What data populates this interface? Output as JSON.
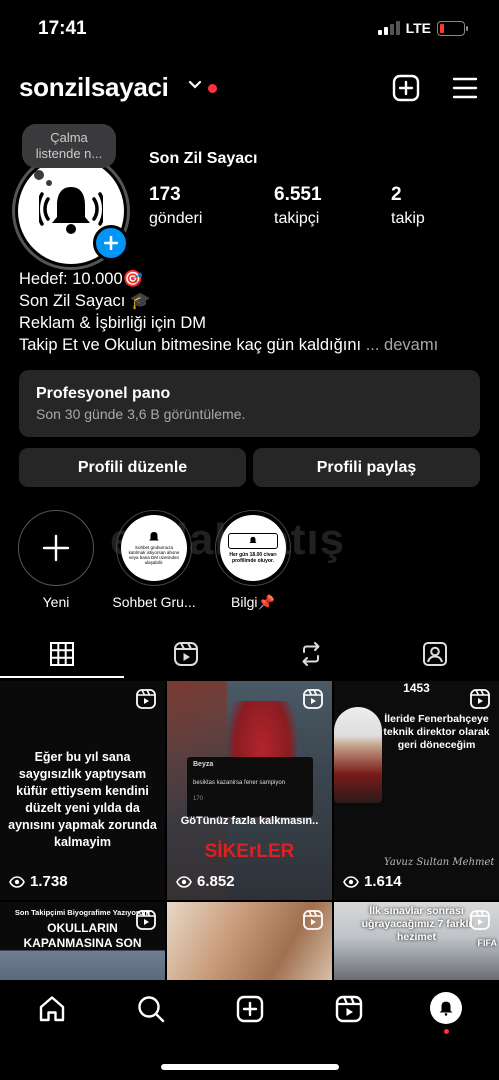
{
  "status_bar": {
    "time": "17:41",
    "network": "LTE",
    "battery_level": 0.15
  },
  "header": {
    "username": "sonzilsayaci"
  },
  "note": {
    "line1": "Çalma",
    "line2": "listende n..."
  },
  "profile": {
    "display_name": "Son Zil Sayacı",
    "stats": [
      {
        "value": "173",
        "label": "gönderi"
      },
      {
        "value": "6.551",
        "label": "takipçi"
      },
      {
        "value": "2",
        "label": "takip"
      }
    ],
    "bio_lines": [
      "Hedef: 10.000🎯",
      "Son Zil Sayacı 🎓",
      "Reklam & İşbirliği için DM",
      "Takip Et ve Okulun bitmesine kaç gün kaldığını"
    ],
    "bio_more": "... devamı"
  },
  "dashboard": {
    "title": "Profesyonel pano",
    "subtitle": "Son 30 günde 3,6 B görüntüleme."
  },
  "buttons": {
    "edit": "Profili düzenle",
    "share": "Profili paylaş"
  },
  "highlights": [
    {
      "label": "Yeni"
    },
    {
      "label": "Sohbet Gru..."
    },
    {
      "label": "Bilgi📌"
    }
  ],
  "highlight_texts": {
    "sohbet": "Sohbet grubumuza katılmak istiyorsan abone veya bana DM üzerinden ulaşabilir.",
    "bilgi": "Her gün 18.00 civarı profilimde oluyor."
  },
  "watermark": "emlaksatış",
  "grid": [
    {
      "views": "1.738",
      "text": "Eğer bu yıl sana saygısızlık yaptıysam küfür ettiysem kendini düzelt yeni yılda da aynısını yapmak zorunda kalmayim"
    },
    {
      "views": "6.852",
      "tweet_user": "Beyza",
      "tweet_text": "besiktas kazanirsa fener sampiyon",
      "tweet_meta": "170",
      "caption1": "GöTünüz fazla kalkmasın..",
      "caption2": "SİKErLER"
    },
    {
      "views": "1.614",
      "top": "1453",
      "text": "İleride Fenerbahçeye teknik direktor olarak geri döneceğim",
      "sign": "Yavuz Sultan Mehmet"
    },
    {
      "text": "Son Takipçimi Biyografime Yazıyorum",
      "big": "OKULLARIN KAPANMASINA SON"
    },
    {
      "text": ""
    },
    {
      "text": "İlk sınavlar sonrası uğrayacağımız 7 farklı hezimet",
      "side": "FIFA"
    }
  ]
}
